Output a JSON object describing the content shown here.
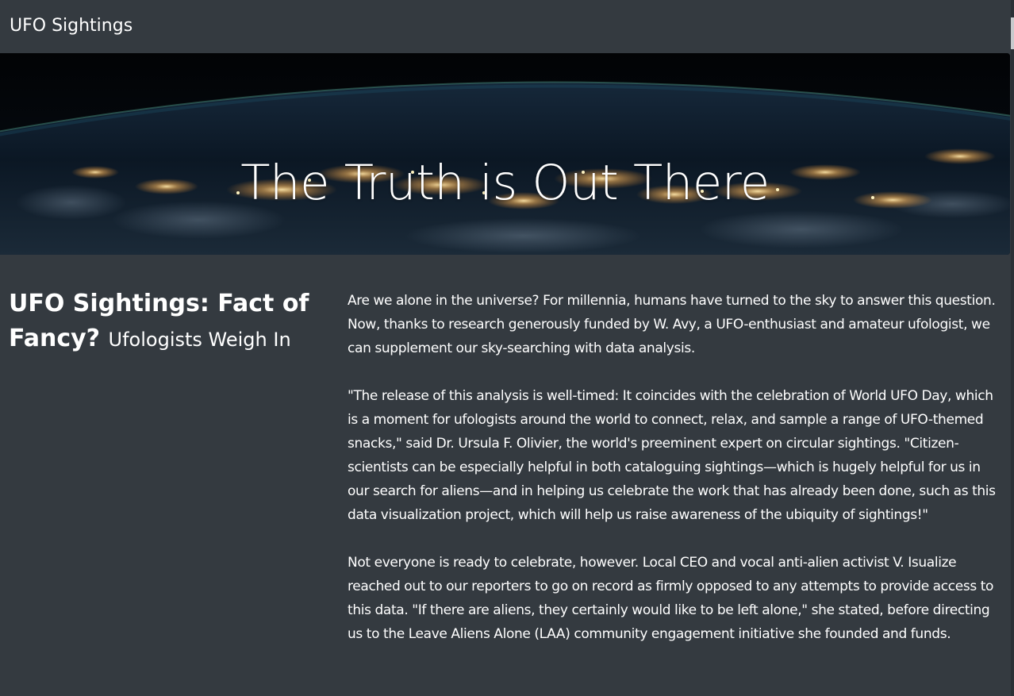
{
  "navbar": {
    "brand": "UFO Sightings"
  },
  "hero": {
    "title": "The Truth is Out There",
    "background_description_icon": "night-earth-from-space-image"
  },
  "article": {
    "heading_main": "UFO Sightings: Fact of Fancy?",
    "heading_sub": "Ufologists Weigh In",
    "paragraphs": [
      "Are we alone in the universe? For millennia, humans have turned to the sky to answer this question. Now, thanks to research generously funded by W. Avy, a UFO-enthusiast and amateur ufologist, we can supplement our sky-searching with data analysis.",
      "\"The release of this analysis is well-timed: It coincides with the celebration of World UFO Day, which is a moment for ufologists around the world to connect, relax, and sample a range of UFO-themed snacks,\" said Dr. Ursula F. Olivier, the world's preeminent expert on circular sightings. \"Citizen-scientists can be especially helpful in both cataloguing sightings—which is hugely helpful for us in our search for aliens—and in helping us celebrate the work that has already been done, such as this data visualization project, which will help us raise awareness of the ubiquity of sightings!\"",
      "Not everyone is ready to celebrate, however. Local CEO and vocal anti-alien activist V. Isualize reached out to our reporters to go on record as firmly opposed to any attempts to provide access to this data. \"If there are aliens, they certainly would like to be left alone,\" she stated, before directing us to the Leave Aliens Alone (LAA) community engagement initiative she founded and funds."
    ]
  },
  "colors": {
    "page_background": "#343a40",
    "text": "#ffffff"
  }
}
